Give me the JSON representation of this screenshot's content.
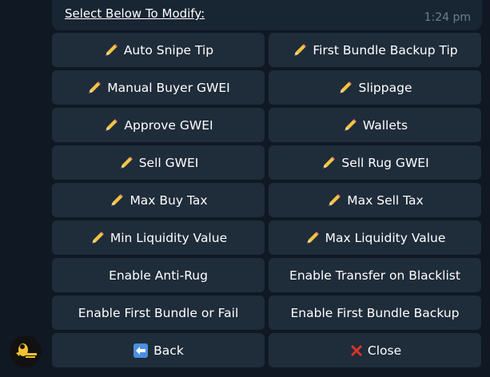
{
  "header": {
    "title": "Select Below To Modify:",
    "time": "1:24 pm"
  },
  "buttons": [
    {
      "label": "Auto Snipe Tip",
      "icon": "pencil-icon"
    },
    {
      "label": "First Bundle Backup Tip",
      "icon": "pencil-icon"
    },
    {
      "label": "Manual Buyer GWEI",
      "icon": "pencil-icon"
    },
    {
      "label": "Slippage",
      "icon": "pencil-icon"
    },
    {
      "label": "Approve GWEI",
      "icon": "pencil-icon"
    },
    {
      "label": "Wallets",
      "icon": "pencil-icon"
    },
    {
      "label": "Sell GWEI",
      "icon": "pencil-icon"
    },
    {
      "label": "Sell Rug GWEI",
      "icon": "pencil-icon"
    },
    {
      "label": "Max Buy Tax",
      "icon": "pencil-icon"
    },
    {
      "label": "Max Sell Tax",
      "icon": "pencil-icon"
    },
    {
      "label": "Min Liquidity Value",
      "icon": "pencil-icon"
    },
    {
      "label": "Max Liquidity Value",
      "icon": "pencil-icon"
    },
    {
      "label": "Enable Anti-Rug",
      "icon": ""
    },
    {
      "label": "Enable Transfer on Blacklist",
      "icon": ""
    },
    {
      "label": "Enable First Bundle or Fail",
      "icon": ""
    },
    {
      "label": "Enable First Bundle Backup",
      "icon": ""
    },
    {
      "label": "Back",
      "icon": "back-arrow-icon"
    },
    {
      "label": "Close",
      "icon": "close-x-icon"
    }
  ],
  "colors": {
    "background": "#0f1823",
    "bubble": "#182533",
    "button": "#1f2c3a",
    "text": "#ffffff",
    "time": "#6d7f8f",
    "close_red": "#e0332b",
    "back_blue": "#4a90e2"
  }
}
